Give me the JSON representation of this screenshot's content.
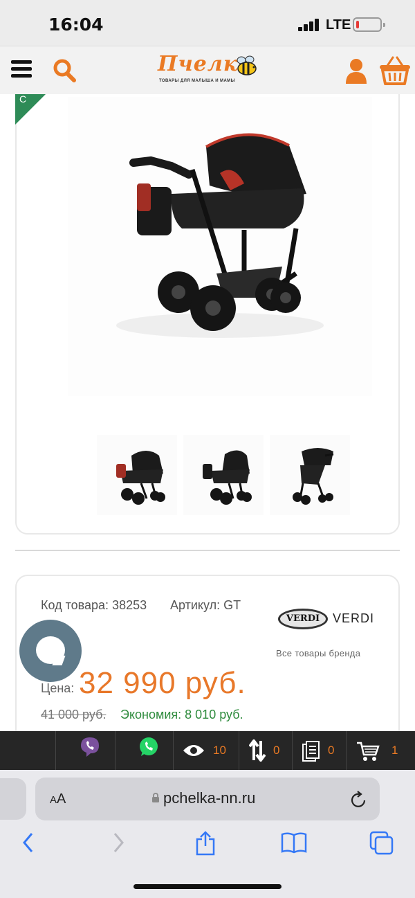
{
  "status_bar": {
    "time": "16:04",
    "network": "LTE",
    "battery_level": 0.08
  },
  "header": {
    "logo_text": "Пчелка",
    "logo_tagline": "ТОВАРЫ ДЛЯ МАЛЫША И МАМЫ",
    "icons": [
      "menu-icon",
      "search-icon",
      "bee-logo-icon",
      "user-icon",
      "cart-icon"
    ]
  },
  "product": {
    "code": "Код товара: 38253",
    "article": "Артикул: GT",
    "brand_logo": "VERDI",
    "brand_name": "VERDI",
    "brand_all": "Все товары бренда",
    "price_label": "Цена:",
    "price": "32 990 руб.",
    "old_price": "41 000 руб.",
    "economy": "Экономия: 8 010 руб.",
    "accent_color": "#e8782a",
    "economy_color": "#2e8b3d"
  },
  "toolbar": {
    "views_count": "10",
    "compare_count": "0",
    "docs_count": "0",
    "cart_count": "1",
    "icons": [
      "viber-icon",
      "whatsapp-icon",
      "eye-icon",
      "compare-icon",
      "list-icon",
      "cart-icon"
    ]
  },
  "browser": {
    "text_size_label_small": "A",
    "text_size_label_large": "A",
    "url": "pchelka-nn.ru",
    "nav_icons": [
      "back-icon",
      "forward-icon",
      "share-icon",
      "bookmarks-icon",
      "tabs-icon"
    ]
  }
}
